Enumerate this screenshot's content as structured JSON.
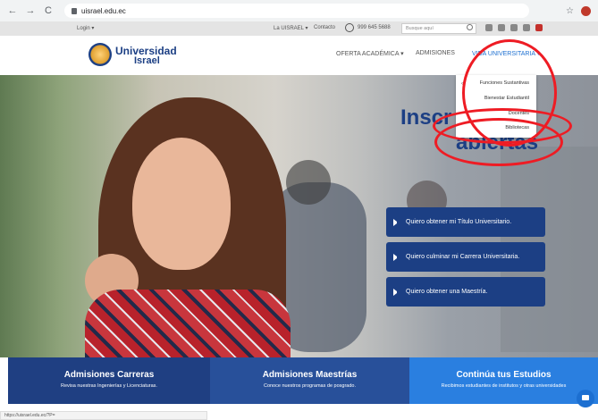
{
  "browser": {
    "url": "uisrael.edu.ec",
    "back_icon": "←",
    "forward_icon": "→",
    "reload_icon": "C",
    "star_icon": "☆"
  },
  "topbar": {
    "login": "Login ▾",
    "la_israel": "La UISRAEL ▾",
    "contacto": "Contacto",
    "phone": "999 645 5688",
    "search_placeholder": "Busque aquí"
  },
  "header": {
    "logo_line1": "Universidad",
    "logo_line2": "Israel",
    "nav": [
      "OFERTA ACADÉMICA ▾",
      "ADMISIONES",
      "VIDA UNIVERSITARIA ▾"
    ]
  },
  "dropdown": {
    "items": [
      "Funciones Sustantivas",
      "Bienestar Estudiantil",
      "Docentes",
      "Bibliotecas"
    ]
  },
  "hero": {
    "headline1": "Inscr",
    "headline2": "abiertas",
    "ctas": [
      "Quiero obtener mi Título Universitario.",
      "Quiero culminar mi Carrera Universitaria.",
      "Quiero obtener una Maestría."
    ]
  },
  "bands": [
    {
      "title": "Admisiones Carreras",
      "sub": "Revisa nuestras Ingenierías y Licenciaturas."
    },
    {
      "title": "Admisiones Maestrías",
      "sub": "Conoce nuestros programas de posgrado."
    },
    {
      "title": "Continúa tus Estudios",
      "sub": "Recibimos estudiantes de institutos y otras universidades"
    }
  ],
  "status_url": "https://uisrael.edu.ec/?P=",
  "colors": {
    "brand": "#1c3f84",
    "accent": "#1c6fd1",
    "annotation": "#ee1c24"
  }
}
